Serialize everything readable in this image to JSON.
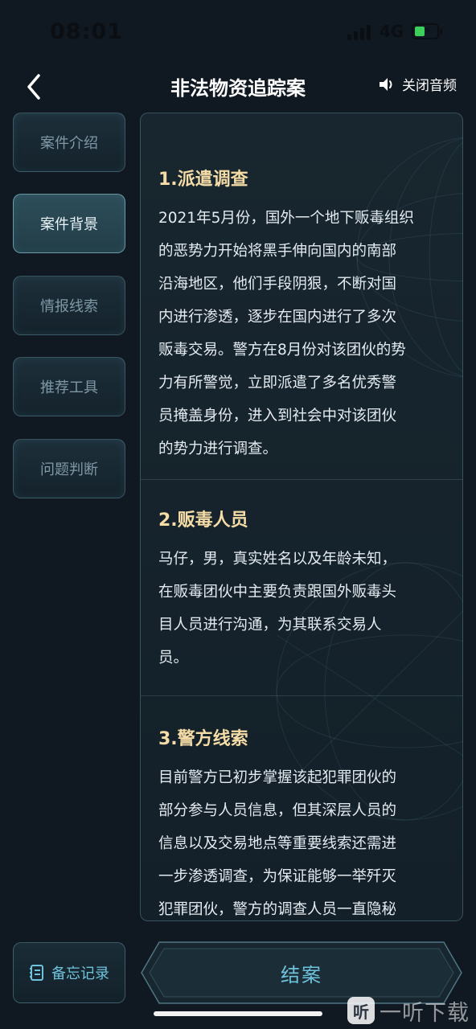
{
  "status_bar": {
    "time": "08:01",
    "network": "4G"
  },
  "header": {
    "title": "非法物资追踪案",
    "audio_label": "关闭音频"
  },
  "sidebar": {
    "items": [
      {
        "label": "案件介绍",
        "active": false
      },
      {
        "label": "案件背景",
        "active": true
      },
      {
        "label": "情报线索",
        "active": false
      },
      {
        "label": "推荐工具",
        "active": false
      },
      {
        "label": "问题判断",
        "active": false
      }
    ]
  },
  "content": {
    "sections": [
      {
        "title": "1.派遣调查",
        "lines": [
          "2021年5月份，国外一个地下贩毒组织",
          "的恶势力开始将黑手伸向国内的南部",
          "沿海地区，他们手段阴狠，不断对国",
          "内进行渗透，逐步在国内进行了多次",
          "贩毒交易。警方在8月份对该团伙的势",
          "力有所警觉，立即派遣了多名优秀警",
          "员掩盖身份，进入到社会中对该团伙",
          "的势力进行调查。"
        ]
      },
      {
        "title": "2.贩毒人员",
        "lines": [
          "马仔，男，真实姓名以及年龄未知，",
          "在贩毒团伙中主要负责跟国外贩毒头",
          "目人员进行沟通，为其联系交易人",
          "员。"
        ]
      },
      {
        "title": "3.警方线索",
        "lines": [
          "目前警方已初步掌握该起犯罪团伙的",
          "部分参与人员信息，但其深层人员的",
          "信息以及交易地点等重要线索还需进",
          "一步渗透调查，为保证能够一举歼灭",
          "犯罪团伙，警方的调查人员一直隐秘"
        ]
      }
    ]
  },
  "bottom": {
    "memo_label": "备忘记录",
    "close_case_label": "结案"
  },
  "watermark": {
    "logo": "听",
    "text": "一听下载"
  },
  "colors": {
    "accent": "#6fc2dc",
    "section_title": "#f5dca6",
    "background": "#101821"
  }
}
